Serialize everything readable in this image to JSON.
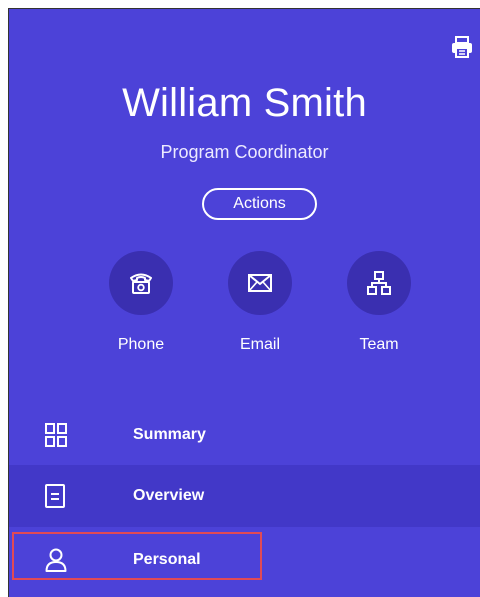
{
  "profile": {
    "name": "William Smith",
    "title": "Program Coordinator",
    "actions_label": "Actions"
  },
  "contacts": [
    {
      "label": "Phone",
      "icon": "phone-icon"
    },
    {
      "label": "Email",
      "icon": "email-icon"
    },
    {
      "label": "Team",
      "icon": "team-icon"
    }
  ],
  "nav": [
    {
      "label": "Summary",
      "icon": "summary-grid-icon"
    },
    {
      "label": "Overview",
      "icon": "document-icon"
    },
    {
      "label": "Personal",
      "icon": "person-icon",
      "highlighted": true
    }
  ],
  "colors": {
    "background": "#4c42d8",
    "circle": "#3a2fb0",
    "highlight_border": "#e04a55"
  }
}
